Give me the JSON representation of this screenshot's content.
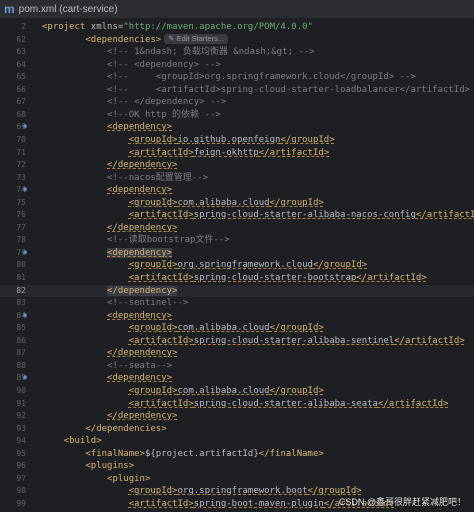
{
  "titlebar": {
    "logo": "m",
    "title": "pom.xml (cart-service)"
  },
  "edit_hint": "Edit Starters...",
  "watermark": "CSDN @鑫哥很胖赶紧减肥吧！",
  "lines": [
    {
      "n": "2",
      "code": [
        [
          "t",
          "<project "
        ],
        [
          "a",
          "xmlns"
        ],
        [
          "b",
          "="
        ],
        [
          "s",
          "\"http://maven.apache.org/POM/4.0.0\""
        ]
      ]
    },
    {
      "n": "62",
      "code": [
        [
          "b",
          "        "
        ],
        [
          "t",
          "<dependencies>"
        ]
      ],
      "hint": true
    },
    {
      "n": "63",
      "code": [
        [
          "c",
          "            <!-- 1&ndash; 负载均衡器 &ndash;&gt; -->"
        ]
      ]
    },
    {
      "n": "64",
      "code": [
        [
          "c",
          "            <!-- <dependency> -->"
        ]
      ]
    },
    {
      "n": "65",
      "code": [
        [
          "c",
          "            <!--     <groupId>org.springframework.cloud</groupId> -->"
        ]
      ]
    },
    {
      "n": "66",
      "code": [
        [
          "c",
          "            <!--     <artifactId>spring-cloud-starter-loadbalancer</artifactId> -->"
        ]
      ]
    },
    {
      "n": "67",
      "code": [
        [
          "c",
          "            <!-- </dependency> -->"
        ]
      ]
    },
    {
      "n": "68",
      "code": [
        [
          "c",
          "            <!--OK http 的依赖 -->"
        ]
      ]
    },
    {
      "n": "69",
      "code": [
        [
          "b",
          "            "
        ],
        [
          "t",
          "<dependency>"
        ]
      ],
      "icon": true
    },
    {
      "n": "70",
      "code": [
        [
          "b",
          "                "
        ],
        [
          "t",
          "<groupId>"
        ],
        [
          "b",
          "io.github.openfeign"
        ],
        [
          "t",
          "</groupId>"
        ]
      ]
    },
    {
      "n": "71",
      "code": [
        [
          "b",
          "                "
        ],
        [
          "t",
          "<artifactId>"
        ],
        [
          "b",
          "feign-okhttp"
        ],
        [
          "t",
          "</artifactId>"
        ]
      ]
    },
    {
      "n": "72",
      "code": [
        [
          "b",
          "            "
        ],
        [
          "t",
          "</dependency>"
        ]
      ]
    },
    {
      "n": "73",
      "code": [
        [
          "c",
          "            <!--nacos配置管理-->"
        ]
      ]
    },
    {
      "n": "74",
      "code": [
        [
          "b",
          "            "
        ],
        [
          "t",
          "<dependency>"
        ]
      ],
      "icon": true
    },
    {
      "n": "75",
      "code": [
        [
          "b",
          "                "
        ],
        [
          "t",
          "<groupId>"
        ],
        [
          "b",
          "com.alibaba.cloud"
        ],
        [
          "t",
          "</groupId>"
        ]
      ]
    },
    {
      "n": "76",
      "code": [
        [
          "b",
          "                "
        ],
        [
          "t",
          "<artifactId>"
        ],
        [
          "b",
          "spring-cloud-starter-alibaba-nacos-config"
        ],
        [
          "t",
          "</artifactId>"
        ]
      ]
    },
    {
      "n": "77",
      "code": [
        [
          "b",
          "            "
        ],
        [
          "t",
          "</dependency>"
        ]
      ]
    },
    {
      "n": "78",
      "code": [
        [
          "c",
          "            <!--读取bootstrap文件-->"
        ]
      ]
    },
    {
      "n": "79",
      "code": [
        [
          "b",
          "            "
        ],
        [
          "t",
          "<dependency>"
        ]
      ],
      "icon": true,
      "box": true
    },
    {
      "n": "80",
      "code": [
        [
          "b",
          "                "
        ],
        [
          "t",
          "<groupId>"
        ],
        [
          "b",
          "org.springframework.cloud"
        ],
        [
          "t",
          "</groupId>"
        ]
      ]
    },
    {
      "n": "81",
      "code": [
        [
          "b",
          "                "
        ],
        [
          "t",
          "<artifactId>"
        ],
        [
          "b",
          "spring-cloud-starter-bootstrap"
        ],
        [
          "t",
          "</artifactId>"
        ]
      ]
    },
    {
      "n": "82",
      "code": [
        [
          "b",
          "            "
        ],
        [
          "t",
          "</dependency>"
        ]
      ],
      "current": true,
      "box": true
    },
    {
      "n": "83",
      "code": [
        [
          "c",
          "            <!--sentinel-->"
        ]
      ]
    },
    {
      "n": "84",
      "code": [
        [
          "b",
          "            "
        ],
        [
          "t",
          "<dependency>"
        ]
      ],
      "icon": true
    },
    {
      "n": "85",
      "code": [
        [
          "b",
          "                "
        ],
        [
          "t",
          "<groupId>"
        ],
        [
          "b",
          "com.alibaba.cloud"
        ],
        [
          "t",
          "</groupId>"
        ]
      ]
    },
    {
      "n": "86",
      "code": [
        [
          "b",
          "                "
        ],
        [
          "t",
          "<artifactId>"
        ],
        [
          "b",
          "spring-cloud-starter-alibaba-sentinel"
        ],
        [
          "t",
          "</artifactId>"
        ]
      ]
    },
    {
      "n": "87",
      "code": [
        [
          "b",
          "            "
        ],
        [
          "t",
          "</dependency>"
        ]
      ]
    },
    {
      "n": "88",
      "code": [
        [
          "c",
          "            <!--seata-->"
        ]
      ]
    },
    {
      "n": "89",
      "code": [
        [
          "b",
          "            "
        ],
        [
          "t",
          "<dependency>"
        ]
      ],
      "icon": true
    },
    {
      "n": "90",
      "code": [
        [
          "b",
          "                "
        ],
        [
          "t",
          "<groupId>"
        ],
        [
          "b",
          "com.alibaba.cloud"
        ],
        [
          "t",
          "</groupId>"
        ]
      ]
    },
    {
      "n": "91",
      "code": [
        [
          "b",
          "                "
        ],
        [
          "t",
          "<artifactId>"
        ],
        [
          "b",
          "spring-cloud-starter-alibaba-seata"
        ],
        [
          "t",
          "</artifactId>"
        ]
      ]
    },
    {
      "n": "92",
      "code": [
        [
          "b",
          "            "
        ],
        [
          "t",
          "</dependency>"
        ]
      ]
    },
    {
      "n": "93",
      "code": [
        [
          "b",
          "        "
        ],
        [
          "t",
          "</dependencies>"
        ]
      ]
    },
    {
      "n": "94",
      "code": [
        [
          "b",
          "    "
        ],
        [
          "t",
          "<build>"
        ]
      ]
    },
    {
      "n": "95",
      "code": [
        [
          "b",
          "        "
        ],
        [
          "t",
          "<finalName>"
        ],
        [
          "b",
          "${project.artifactId}"
        ],
        [
          "t",
          "</finalName>"
        ]
      ]
    },
    {
      "n": "96",
      "code": [
        [
          "b",
          "        "
        ],
        [
          "t",
          "<plugins>"
        ]
      ]
    },
    {
      "n": "97",
      "code": [
        [
          "b",
          "            "
        ],
        [
          "t",
          "<plugin>"
        ]
      ]
    },
    {
      "n": "98",
      "code": [
        [
          "b",
          "                "
        ],
        [
          "t",
          "<groupId>"
        ],
        [
          "b",
          "org.springframework.boot"
        ],
        [
          "t",
          "</groupId>"
        ]
      ]
    },
    {
      "n": "99",
      "code": [
        [
          "b",
          "                "
        ],
        [
          "t",
          "<artifactId>"
        ],
        [
          "b",
          "spring-boot-maven-plugin"
        ],
        [
          "t",
          "</artifactId>"
        ]
      ]
    }
  ]
}
